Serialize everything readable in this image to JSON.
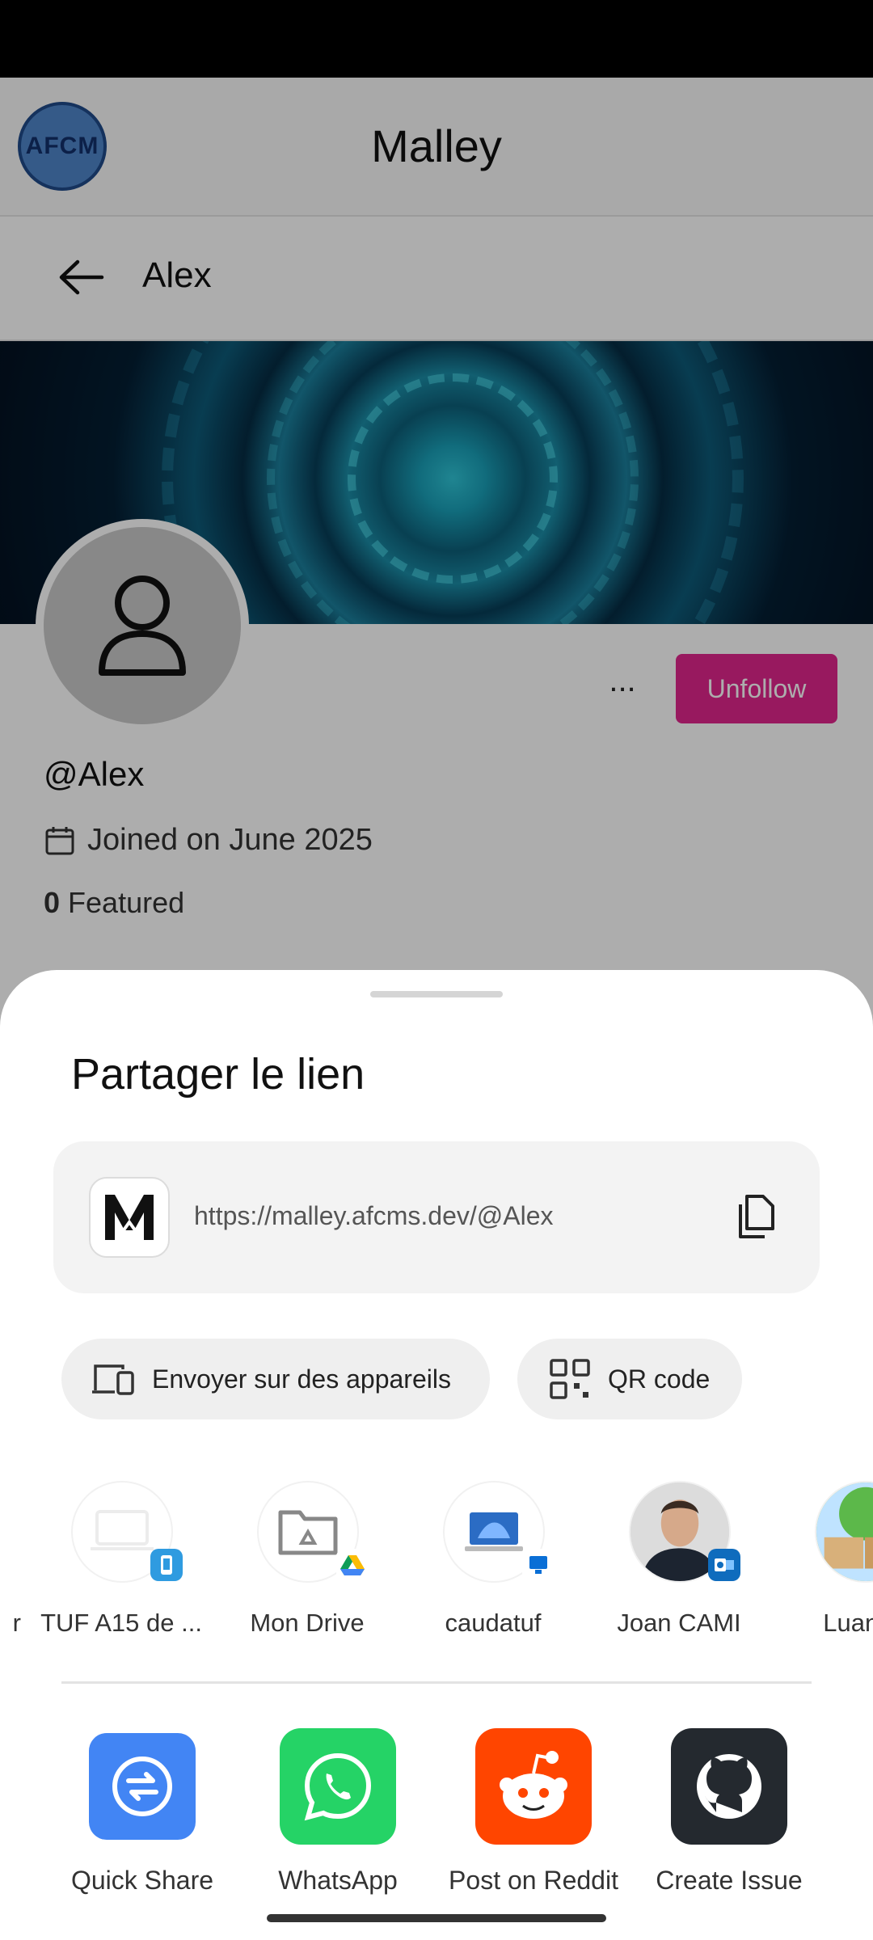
{
  "app": {
    "logo_text": "AFCM",
    "title": "Malley",
    "subtitle": "Alex"
  },
  "profile": {
    "more_label": "...",
    "unfollow_label": "Unfollow",
    "handle": "@Alex",
    "joined_text": "Joined on June 2025",
    "featured_count": "0",
    "featured_label": "Featured"
  },
  "sheet": {
    "title": "Partager le lien",
    "link_url": "https://malley.afcms.dev/@Alex",
    "favicon_letter": "M",
    "send_devices_label": "Envoyer sur des appareils",
    "qr_label": "QR code",
    "direct_share": [
      {
        "label": "r"
      },
      {
        "label": "TUF A15 de ..."
      },
      {
        "label": "Mon Drive"
      },
      {
        "label": "caudatuf"
      },
      {
        "label": "Joan CAMI"
      },
      {
        "label": "Luanti -"
      }
    ],
    "apps": [
      {
        "label": "Quick Share",
        "color": "#4285f4"
      },
      {
        "label": "WhatsApp",
        "color": "#25d366"
      },
      {
        "label": "Post on Reddit",
        "color": "#ff4500"
      },
      {
        "label": "Create Issue",
        "color": "#24292f"
      }
    ]
  },
  "colors": {
    "accent": "#e0258c",
    "link_card_bg": "#f3f3f3"
  }
}
